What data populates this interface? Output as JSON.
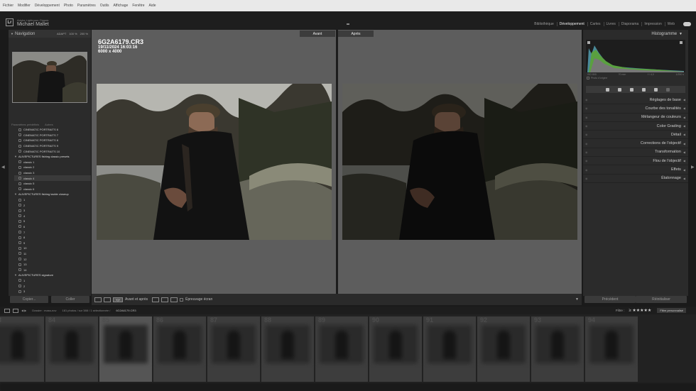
{
  "menubar": [
    "Fichier",
    "Modifier",
    "Développement",
    "Photo",
    "Paramètres",
    "Outils",
    "Affichage",
    "Fenêtre",
    "Aide"
  ],
  "app": {
    "logo": "Lr",
    "subtitle": "Adobe Lightroom Classic",
    "user": "Michael Mallet"
  },
  "modules": [
    "Bibliothèque",
    "Développement",
    "Cartes",
    "Livres",
    "Diaporama",
    "Impression",
    "Web"
  ],
  "navigator": {
    "title": "Navigation",
    "zoom": [
      "ADAPT",
      "100 %",
      "200 %"
    ]
  },
  "presets_header": "Paramètres prédéfinis",
  "presets_header_extra": "Autres",
  "presets": [
    {
      "type": "item",
      "label": "CINEMATIC PORTRAITS 6"
    },
    {
      "type": "item",
      "label": "CINEMATIC PORTRAITS 7"
    },
    {
      "type": "item",
      "label": "CINEMATIC PORTRAITS 8"
    },
    {
      "type": "item",
      "label": "CINEMATIC PORTRAITS 9"
    },
    {
      "type": "item",
      "label": "CINEMATIC PORTRAITS 10"
    },
    {
      "type": "group",
      "label": "ALIVEPICTURES fishing classic presets"
    },
    {
      "type": "item",
      "label": "classic 1"
    },
    {
      "type": "item",
      "label": "classic 2"
    },
    {
      "type": "item",
      "label": "classic 3"
    },
    {
      "type": "item",
      "label": "classic 4"
    },
    {
      "type": "item",
      "label": "classic 5"
    },
    {
      "type": "item",
      "label": "classic 6"
    },
    {
      "type": "group",
      "label": "ALIVEPICTURES fishing tackle closeup"
    },
    {
      "type": "item",
      "label": "1"
    },
    {
      "type": "item",
      "label": "2"
    },
    {
      "type": "item",
      "label": "3"
    },
    {
      "type": "item",
      "label": "4"
    },
    {
      "type": "item",
      "label": "5"
    },
    {
      "type": "item",
      "label": "6"
    },
    {
      "type": "item",
      "label": "7"
    },
    {
      "type": "item",
      "label": "8"
    },
    {
      "type": "item",
      "label": "9"
    },
    {
      "type": "item",
      "label": "10"
    },
    {
      "type": "item",
      "label": "11"
    },
    {
      "type": "item",
      "label": "12"
    },
    {
      "type": "item",
      "label": "13"
    },
    {
      "type": "item",
      "label": "14"
    },
    {
      "type": "group",
      "label": "ALIVEPICTURES signature"
    },
    {
      "type": "item",
      "label": "1"
    },
    {
      "type": "item",
      "label": "2"
    },
    {
      "type": "item",
      "label": "3"
    }
  ],
  "left_buttons": {
    "copy": "Copier...",
    "paste": "Coller"
  },
  "compare": {
    "before": "Avant",
    "after": "Après"
  },
  "photo_info": {
    "filename": "6G2A6179.CR3",
    "datetime": "19/11/2024 16:03:16",
    "dimensions": "6000 x 4000"
  },
  "toolbar": {
    "yy": "Y|Y",
    "mode_label": "Avant et après",
    "softproof": "Épreuvage écran"
  },
  "histogram": {
    "title": "Histogramme",
    "info": [
      "ISO 800",
      "70 mm",
      "f / 4,0",
      "1/250 s"
    ],
    "original": "Photo d'origine"
  },
  "sections": [
    "Réglages de base",
    "Courbe des tonalités",
    "Mélangeur de couleurs",
    "Color Grading",
    "Détail",
    "Corrections de l'objectif",
    "Transformation",
    "Flou de l'objectif",
    "Effets",
    "Étalonnage"
  ],
  "right_buttons": {
    "previous": "Précédent",
    "reset": "Réinitialiser"
  },
  "filmstrip_bar": {
    "source": "Dossier : mass-nov",
    "count": "181 photos / sur 388 / 1 sélectionnée /",
    "current": "6G2A6179.CR3",
    "filter": "Filtre :",
    "stars": "≥ ★★★★★",
    "filter_mode": "Filtre personnalisé"
  },
  "filmstrip_numbers": [
    "83",
    "84",
    "85",
    "86",
    "87",
    "88",
    "89",
    "90",
    "91",
    "92",
    "93",
    "94"
  ]
}
